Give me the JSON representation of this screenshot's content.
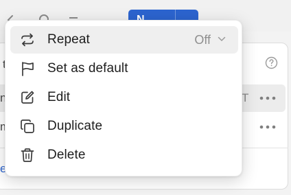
{
  "background": {
    "new_button_label": "N",
    "row_fragments": [
      "t",
      "n",
      "m"
    ],
    "row_trailing_text": "T",
    "link_fragment": "e"
  },
  "menu": {
    "items": [
      {
        "label": "Repeat",
        "icon": "repeat-icon",
        "value": "Off"
      },
      {
        "label": "Set as default",
        "icon": "flag-icon"
      },
      {
        "label": "Edit",
        "icon": "edit-icon"
      },
      {
        "label": "Duplicate",
        "icon": "duplicate-icon"
      },
      {
        "label": "Delete",
        "icon": "trash-icon"
      }
    ]
  },
  "colors": {
    "accent": "#2c64cf",
    "menu_highlight": "#efefef"
  }
}
